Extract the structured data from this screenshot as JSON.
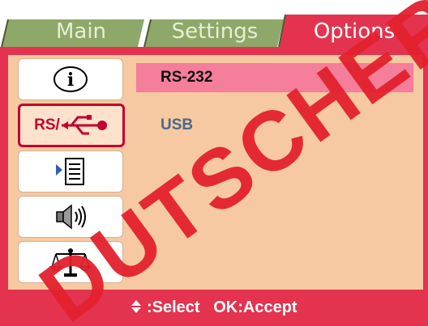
{
  "tabs": [
    {
      "label": "Main",
      "active": false
    },
    {
      "label": "Settings",
      "active": false
    },
    {
      "label": "Options",
      "active": true
    }
  ],
  "sidebar": {
    "items": [
      {
        "icon": "info-icon"
      },
      {
        "icon": "rs232-usb-icon",
        "rs_label": "RS/",
        "active": true
      },
      {
        "icon": "list-icon"
      },
      {
        "icon": "speaker-icon"
      },
      {
        "icon": "balance-scale-icon"
      }
    ]
  },
  "options": {
    "items": [
      {
        "label": "RS-232",
        "selected": true
      },
      {
        "label": "USB",
        "selected": false
      }
    ]
  },
  "footer": {
    "select_hint": ":Select",
    "accept_hint": "OK:Accept",
    "arrow_icon": "up-down-arrow-icon"
  },
  "watermark": {
    "text": "DUTSCHER"
  },
  "colors": {
    "accent": "#e3334f",
    "panel": "#f7c9a2",
    "tab_inactive": "#8ea86a",
    "selected_row": "#f57e9a"
  }
}
